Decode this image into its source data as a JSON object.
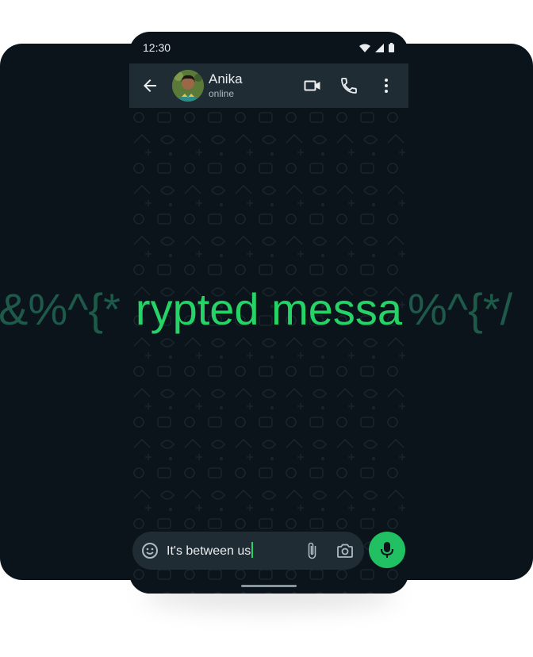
{
  "status_bar": {
    "time": "12:30"
  },
  "header": {
    "contact_name": "Anika",
    "contact_status": "online"
  },
  "composer": {
    "message_text": "It's between us"
  },
  "overlay": {
    "center_text": "rypted messa",
    "left_text": "&%^{*",
    "right_text": "%^{*/"
  },
  "colors": {
    "background": "#0b141a",
    "header": "#1f2c34",
    "accent_green": "#25d366",
    "ghost_text": "#1d5a4a"
  }
}
